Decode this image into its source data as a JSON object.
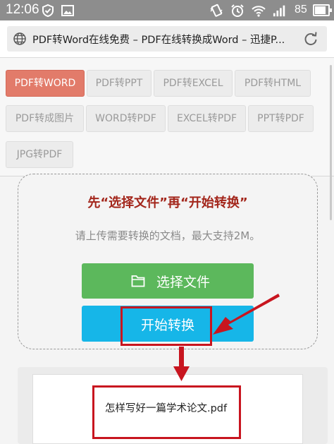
{
  "status_bar": {
    "time": "12:06",
    "battery": "85",
    "battery_fraction": 0.85,
    "icons": [
      "shield-icon",
      "image-icon",
      "vibrate-icon",
      "alarm-icon",
      "wifi-icon",
      "signal-icon",
      "battery-icon"
    ]
  },
  "browser": {
    "url_text": "PDF转Word在线免费 – PDF在线转换成Word – 迅捷P...",
    "icons": [
      "globe-icon",
      "reload-icon"
    ]
  },
  "tabs": [
    {
      "label": "PDF转WORD",
      "active": true
    },
    {
      "label": "PDF转PPT",
      "active": false
    },
    {
      "label": "PDF转EXCEL",
      "active": false
    },
    {
      "label": "PDF转HTML",
      "active": false
    },
    {
      "label": "PDF转成图片",
      "active": false
    },
    {
      "label": "WORD转PDF",
      "active": false
    },
    {
      "label": "EXCEL转PDF",
      "active": false
    },
    {
      "label": "PPT转PDF",
      "active": false
    },
    {
      "label": "JPG转PDF",
      "active": false
    }
  ],
  "upload": {
    "title": "先“选择文件”再“开始转换”",
    "hint": "请上传需要转换的文档，最大支持2M。",
    "select_label": "选择文件",
    "convert_label": "开始转换"
  },
  "result": {
    "file_name": "怎样写好一篇学术论文.pdf"
  },
  "colors": {
    "active_tab": "#e27b6a",
    "select_button": "#5cb85c",
    "convert_button": "#16b6e8",
    "title_red": "#a3261b",
    "annotation_red": "#c8151f"
  }
}
